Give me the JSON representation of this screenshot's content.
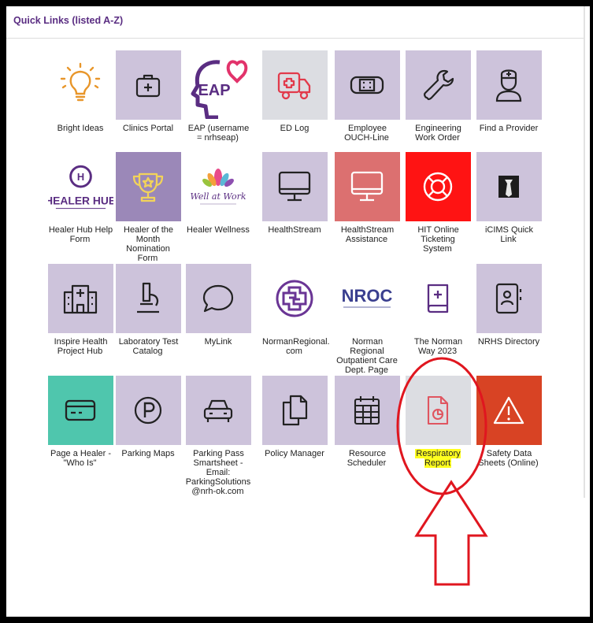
{
  "header": {
    "title": "Quick Links (listed A-Z)"
  },
  "tiles": [
    {
      "label": "Bright Ideas",
      "icon": "lightbulb-icon"
    },
    {
      "label": "Clinics Portal",
      "icon": "first-aid-kit-icon"
    },
    {
      "label": "EAP (username = nrhseap)",
      "icon": "eap-logo",
      "logo_text": "EAP"
    },
    {
      "label": "ED Log",
      "icon": "ambulance-icon"
    },
    {
      "label": "Employee OUCH-Line",
      "icon": "bandage-icon"
    },
    {
      "label": "Engineering Work Order",
      "icon": "wrench-icon"
    },
    {
      "label": "Find a Provider",
      "icon": "doctor-icon"
    },
    {
      "label": "Healer Hub Help Form",
      "icon": "healer-hub-logo",
      "logo_text": "HEALER HUB"
    },
    {
      "label": "Healer of the Month Nomination Form",
      "icon": "trophy-icon"
    },
    {
      "label": "Healer Wellness",
      "icon": "lotus-logo",
      "logo_text": "Well at Work"
    },
    {
      "label": "HealthStream",
      "icon": "monitor-icon"
    },
    {
      "label": "HealthStream Assistance",
      "icon": "monitor-icon"
    },
    {
      "label": "HIT Online Ticketing System",
      "icon": "lifebuoy-icon"
    },
    {
      "label": "iCIMS Quick Link",
      "icon": "icims-logo"
    },
    {
      "label": "Inspire Health Project Hub",
      "icon": "hospital-icon"
    },
    {
      "label": "Laboratory Test Catalog",
      "icon": "microscope-icon"
    },
    {
      "label": "MyLink",
      "icon": "chat-bubble-icon"
    },
    {
      "label": "NormanRegional. com",
      "icon": "norman-regional-logo"
    },
    {
      "label": "Norman Regional Outpatient Care Dept. Page",
      "icon": "nroc-logo",
      "logo_text": "NROC"
    },
    {
      "label": "The Norman Way 2023",
      "icon": "book-icon"
    },
    {
      "label": "NRHS Directory",
      "icon": "contact-book-icon"
    },
    {
      "label": "Page a Healer - \"Who Is\"",
      "icon": "card-icon"
    },
    {
      "label": "Parking Maps",
      "icon": "parking-icon"
    },
    {
      "label": "Parking Pass Smartsheet - Email: ParkingSolutions @nrh-ok.com",
      "icon": "car-icon"
    },
    {
      "label": "Policy Manager",
      "icon": "copy-icon"
    },
    {
      "label": "Resource Scheduler",
      "icon": "calendar-icon"
    },
    {
      "label": "Respiratory Report",
      "icon": "report-chart-icon",
      "highlighted": true
    },
    {
      "label": "Safety Data Sheets (Online)",
      "icon": "warning-icon"
    }
  ],
  "colors": {
    "title": "#5a2d82",
    "tile_purple": "#cdc3db",
    "tile_grey": "#dcdde2",
    "annotation_red": "#e0161f",
    "highlight": "#ffff1f"
  }
}
